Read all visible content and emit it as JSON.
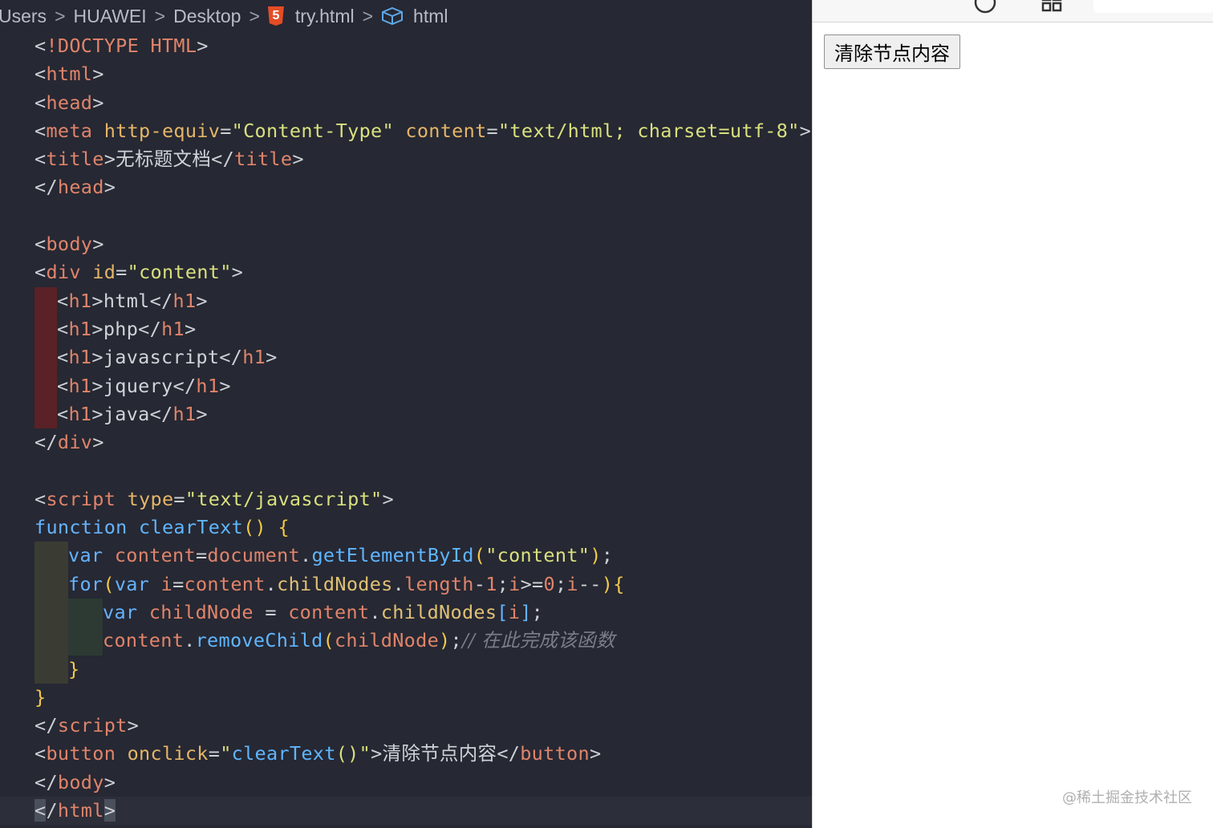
{
  "breadcrumb": {
    "items": [
      "Users",
      "HUAWEI",
      "Desktop",
      "try.html",
      "html"
    ],
    "separator": ">"
  },
  "code": {
    "l1": {
      "a": "<!",
      "b": "DOCTYPE HTML",
      ">": ">"
    },
    "html_tag": "html",
    "head_tag": "head",
    "meta_tag": "meta",
    "title_tag": "title",
    "body_tag": "body",
    "div_tag": "div",
    "h1_tag": "h1",
    "script_tag": "script",
    "button_tag": "button",
    "http_equiv_attr": "http-equiv",
    "content_attr": "content",
    "id_attr": "id",
    "type_attr": "type",
    "onclick_attr": "onclick",
    "http_equiv_val": "\"Content-Type\"",
    "content_val": "\"text/html; charset=utf-8\"",
    "title_text": "无标题文档",
    "id_val": "\"content\"",
    "h1_items": [
      "html",
      "php",
      "javascript",
      "jquery",
      "java"
    ],
    "type_val": "\"text/javascript\"",
    "kw_function": "function",
    "fn_name": "clearText",
    "kw_var": "var",
    "v_content": "content",
    "v_document": "document",
    "fn_get": "getElementById",
    "str_content": "\"content\"",
    "kw_for": "for",
    "v_i": "i",
    "p_childNodes": "childNodes",
    "p_length": "length",
    "num_1": "1",
    "num_0": "0",
    "v_childNode": "childNode",
    "fn_remove": "removeChild",
    "comment": "// 在此完成该函数",
    "onclick_val_1": "\"clearText",
    "onclick_val_2": "()\"",
    "button_text": "清除节点内容"
  },
  "preview": {
    "button_label": "清除节点内容",
    "watermark": "@稀土掘金技术社区"
  },
  "colors": {
    "editor_bg": "#262833",
    "tag": "#e0846a",
    "attr": "#e5b567",
    "string": "#d9e07e",
    "keyword": "#66b3ff",
    "comment": "#7a7e8a"
  }
}
